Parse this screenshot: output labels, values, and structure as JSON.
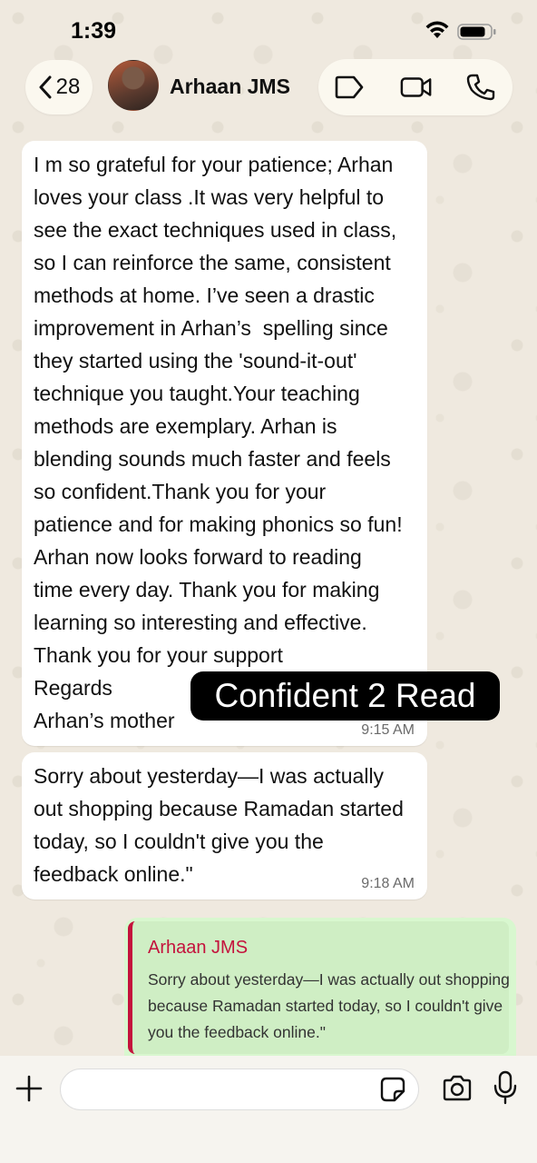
{
  "status_bar": {
    "time": "1:39"
  },
  "header": {
    "back_count": "28",
    "contact_name": "Arhaan JMS"
  },
  "messages": [
    {
      "text": "I m so grateful for your patience; Arhan\nloves your class .It was very helpful to\nsee the exact techniques used in class,\nso I can reinforce the same, consistent\nmethods at home. I’ve seen a drastic\nimprovement in Arhan’s  spelling since\nthey started using the 'sound-it-out'\ntechnique you taught.Your teaching\nmethods are exemplary. Arhan is\nblending sounds much faster and feels\nso confident.Thank you for your\npatience and for making phonics so fun!\nArhan now looks forward to reading\ntime every day. Thank you for making\nlearning so interesting and effective.\nThank you for your support\nRegards\nArhan’s mother",
      "time": "9:15 AM"
    },
    {
      "text": "Sorry about yesterday—I was actually\nout shopping because Ramadan started\ntoday, so I couldn't give you the\nfeedback online.\"",
      "time": "9:18 AM"
    }
  ],
  "overlay_label": "Confident 2 Read",
  "reply": {
    "quoted_author": "Arhaan JMS",
    "quoted_text": "Sorry about yesterday—I was actually out shopping because Ramadan started today, so I couldn't give you the feedback online.\""
  },
  "composer": {
    "value": ""
  },
  "colors": {
    "quote_accent": "#c4123c",
    "outgoing_bubble": "#d8f7cf",
    "incoming_bubble": "#ffffff"
  }
}
